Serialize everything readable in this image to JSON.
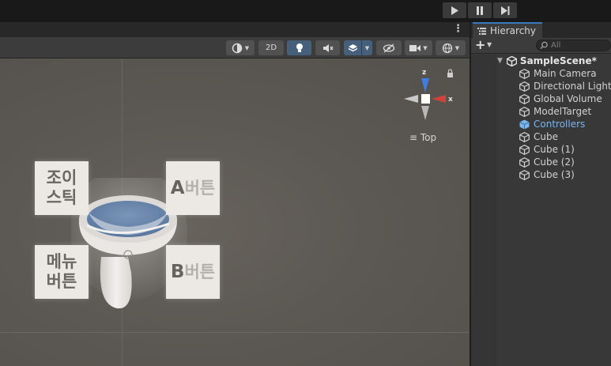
{
  "playbar": {
    "play_icon": "play-icon",
    "pause_icon": "pause-icon",
    "step_icon": "step-icon"
  },
  "scene": {
    "toolbar": {
      "shading_icon": "shading-sphere-icon",
      "mode_2d": "2D",
      "lighting_icon": "lightbulb-icon",
      "audio_icon": "audio-mute-icon",
      "effects_icon": "effects-layers-icon",
      "hidden_icon": "eye-slash-icon",
      "camera_icon": "camera-icon",
      "gizmos_icon": "gizmos-globe-icon"
    },
    "gizmo": {
      "axis_z": "z",
      "axis_x": "x",
      "view_label": "Top",
      "lock_icon": "lock-icon",
      "menu_icon": "hamburger-icon"
    },
    "labels": {
      "joystick_line1": "조이",
      "joystick_line2": "스틱",
      "a_big": "A",
      "a_rest": "버튼",
      "menu_line1": "메뉴",
      "menu_line2": "버튼",
      "b_big": "B",
      "b_rest": "버튼"
    }
  },
  "hierarchy": {
    "tab_label": "Hierarchy",
    "add_label": "+",
    "search_placeholder": "All",
    "scene_name": "SampleScene*",
    "items": [
      {
        "label": "Main Camera"
      },
      {
        "label": "Directional Light"
      },
      {
        "label": "Global Volume"
      },
      {
        "label": "ModelTarget"
      },
      {
        "label": "Controllers"
      },
      {
        "label": "Cube"
      },
      {
        "label": "Cube (1)"
      },
      {
        "label": "Cube (2)"
      },
      {
        "label": "Cube (3)"
      }
    ],
    "colors": {
      "prefab_blue": "#7cb5ec",
      "selected_tab_accent": "#3a79bb"
    }
  }
}
